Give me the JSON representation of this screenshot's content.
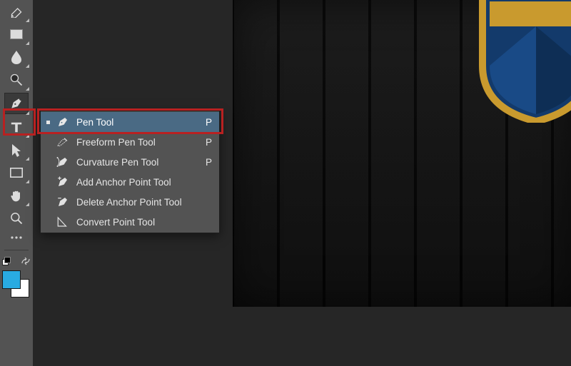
{
  "flyout": {
    "items": [
      {
        "label": "Pen Tool",
        "shortcut": "P",
        "selected": true
      },
      {
        "label": "Freeform Pen Tool",
        "shortcut": "P",
        "selected": false
      },
      {
        "label": "Curvature Pen Tool",
        "shortcut": "P",
        "selected": false
      },
      {
        "label": "Add Anchor Point Tool",
        "shortcut": "",
        "selected": false
      },
      {
        "label": "Delete Anchor Point Tool",
        "shortcut": "",
        "selected": false
      },
      {
        "label": "Convert Point Tool",
        "shortcut": "",
        "selected": false
      }
    ]
  },
  "colors": {
    "foreground": "#29abe2",
    "background": "#ffffff",
    "highlight": "#b82121"
  }
}
